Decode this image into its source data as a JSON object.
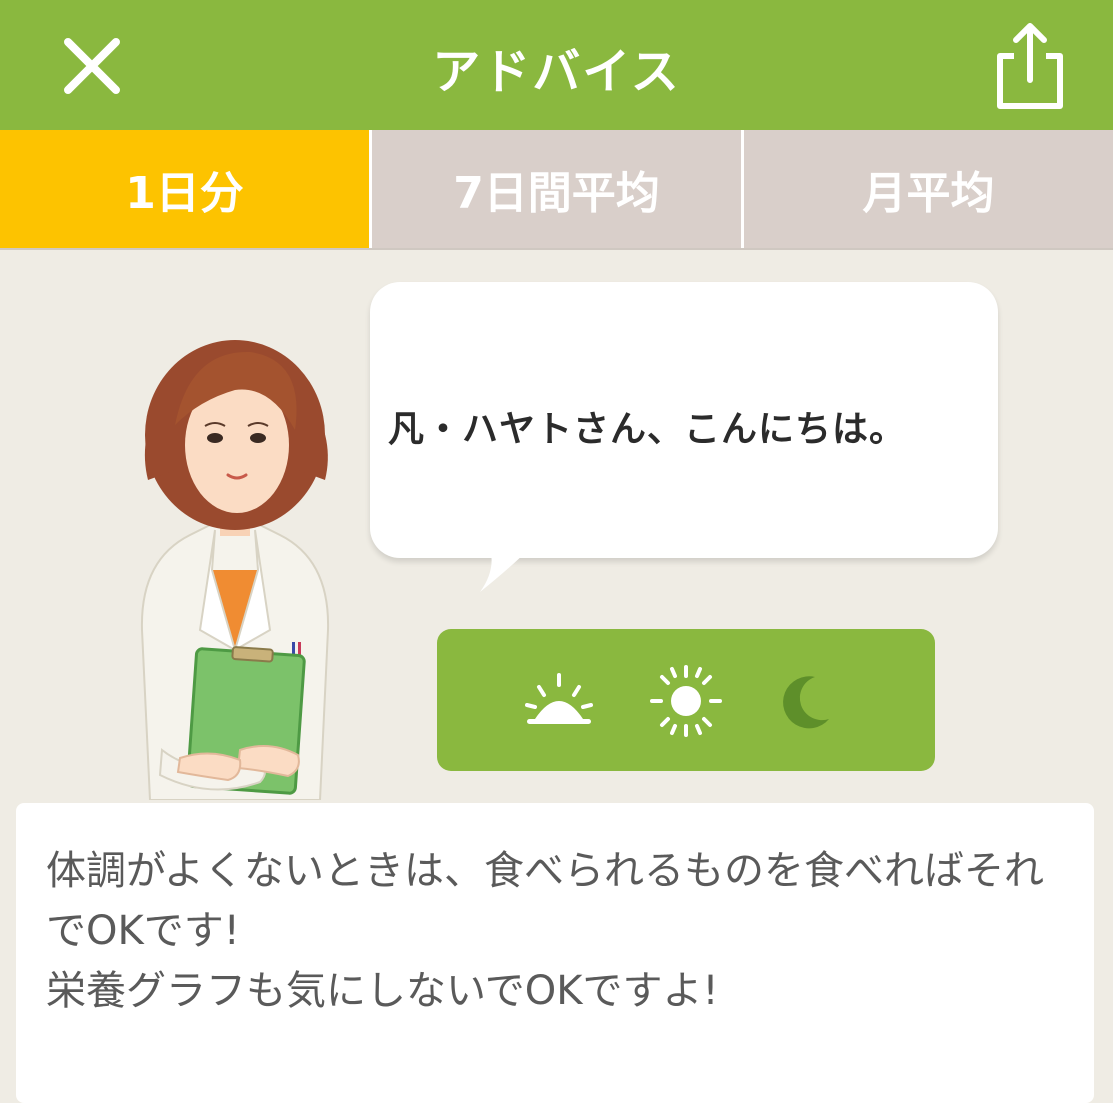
{
  "header": {
    "title": "アドバイス",
    "close_icon": "close-icon",
    "share_icon": "share-icon"
  },
  "tabs": [
    {
      "label": "1日分",
      "active": true
    },
    {
      "label": "7日間平均",
      "active": false
    },
    {
      "label": "月平均",
      "active": false
    }
  ],
  "greeting": {
    "text": "凡・ハヤトさん、こんにちは。"
  },
  "time_of_day": {
    "icons": [
      "sunrise-icon",
      "sun-icon",
      "moon-icon"
    ],
    "selected": "moon-icon"
  },
  "advice": {
    "text": "体調がよくないときは、食べられるものを食べればそれでOKです!\n栄養グラフも気にしないでOKですよ!"
  },
  "colors": {
    "brand_green": "#8ab83f",
    "active_tab": "#fdc300",
    "inactive_tab": "#d9cfca",
    "background": "#efece4"
  }
}
